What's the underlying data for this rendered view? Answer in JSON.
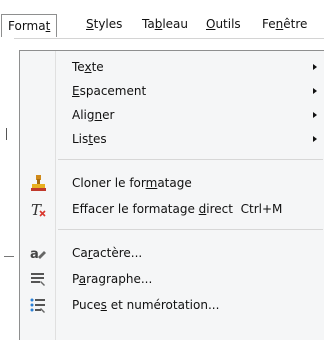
{
  "menubar": {
    "format": {
      "pre": "Forma",
      "u": "t",
      "post": ""
    },
    "styles": {
      "pre": "",
      "u": "S",
      "post": "tyles"
    },
    "tableau": {
      "pre": "Ta",
      "u": "b",
      "post": "leau"
    },
    "outils": {
      "pre": "",
      "u": "O",
      "post": "utils"
    },
    "fenetre": {
      "pre": "Fe",
      "u": "n",
      "post": "être"
    }
  },
  "menu": {
    "texte": {
      "pre": "Te",
      "u": "x",
      "post": "te"
    },
    "espacement": {
      "pre": "",
      "u": "E",
      "post": "spacement"
    },
    "aligner": {
      "pre": "Alig",
      "u": "n",
      "post": "er"
    },
    "listes": {
      "pre": "Lis",
      "u": "t",
      "post": "es"
    },
    "cloner": {
      "pre": "Cloner le for",
      "u": "m",
      "post": "atage"
    },
    "effacer": {
      "pre": "Effacer le formatage ",
      "u": "d",
      "post": "irect",
      "shortcut": "Ctrl+M"
    },
    "caractere": {
      "pre": "Ca",
      "u": "r",
      "post": "actère..."
    },
    "paragraphe": {
      "pre": "P",
      "u": "a",
      "post": "ragraphe..."
    },
    "puces": {
      "pre": "Puce",
      "u": "s",
      "post": " et numérotation..."
    }
  },
  "icons": {
    "clone": "paintbrush-icon",
    "clear": "clear-formatting-icon",
    "character": "character-icon",
    "paragraph": "paragraph-icon",
    "bullets": "bullets-numbering-icon"
  }
}
